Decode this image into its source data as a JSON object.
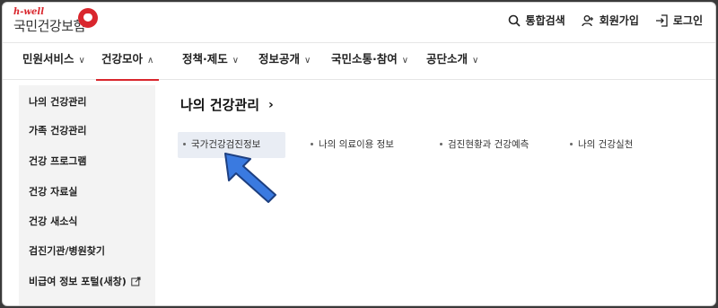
{
  "header": {
    "logo_top": "h-well",
    "logo_main": "국민건강보험",
    "utilities": [
      {
        "label": "통합검색",
        "icon": "search-icon"
      },
      {
        "label": "회원가입",
        "icon": "user-add-icon"
      },
      {
        "label": "로그인",
        "icon": "login-icon"
      }
    ]
  },
  "gnb": {
    "items": [
      {
        "label": "민원서비스",
        "state": "collapsed"
      },
      {
        "label": "건강모아",
        "state": "expanded"
      },
      {
        "label": "정책·제도",
        "state": "collapsed"
      },
      {
        "label": "정보공개",
        "state": "collapsed"
      },
      {
        "label": "국민소통·참여",
        "state": "collapsed"
      },
      {
        "label": "공단소개",
        "state": "collapsed"
      }
    ],
    "chevron_down": "∨",
    "chevron_up": "∧"
  },
  "sidebar": {
    "items": [
      {
        "label": "나의 건강관리"
      },
      {
        "label": "가족 건강관리"
      },
      {
        "label": "건강 프로그램"
      },
      {
        "label": "건강 자료실"
      },
      {
        "label": "건강 새소식"
      },
      {
        "label": "검진기관/병원찾기"
      },
      {
        "label": "비급여 정보 포털(새창)",
        "icon": "external-link-icon"
      }
    ]
  },
  "content": {
    "title": "나의 건강관리",
    "title_arrow": "›",
    "links": [
      {
        "label": "국가건강검진정보",
        "selected": true
      },
      {
        "label": "나의 의료이용 정보"
      },
      {
        "label": "검진현황과 건강예측"
      },
      {
        "label": "나의 건강실천"
      }
    ]
  },
  "colors": {
    "brand": "#d9262d",
    "pointer_fill": "#3a7ae0"
  }
}
